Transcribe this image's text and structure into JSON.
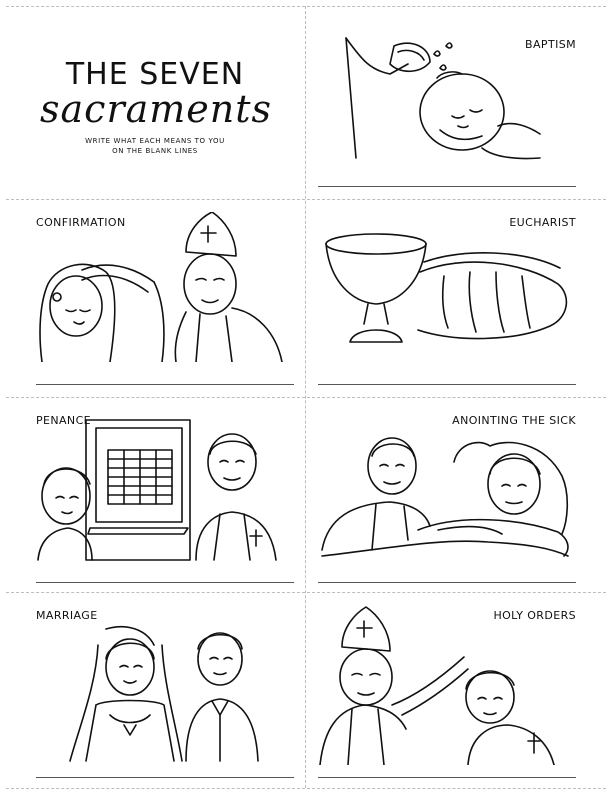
{
  "header": {
    "title_line1": "THE SEVEN",
    "title_line2": "sacraments",
    "instructions_line1": "WRITE WHAT EACH MEANS TO YOU",
    "instructions_line2": "ON THE BLANK LINES"
  },
  "cards": {
    "baptism": {
      "label": "BAPTISM"
    },
    "confirmation": {
      "label": "CONFIRMATION"
    },
    "eucharist": {
      "label": "EUCHARIST"
    },
    "penance": {
      "label": "PENANCE"
    },
    "anointing": {
      "label": "ANOINTING THE SICK"
    },
    "marriage": {
      "label": "MARRIAGE"
    },
    "holy_orders": {
      "label": "HOLY ORDERS"
    }
  }
}
